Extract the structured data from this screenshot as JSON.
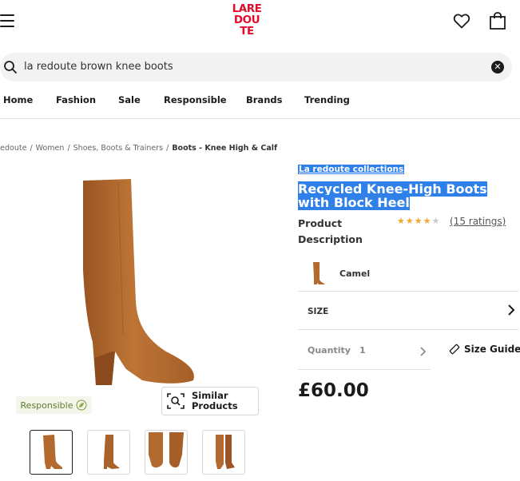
{
  "header": {
    "logo_lines": [
      "LARE",
      "DOU",
      "TE"
    ],
    "brand_color": "#e10b2c"
  },
  "search": {
    "query": "la redoute brown knee boots"
  },
  "nav": {
    "items": [
      "Home",
      "Fashion",
      "Sale",
      "Responsible",
      "Brands",
      "Trending"
    ]
  },
  "breadcrumb": {
    "items": [
      "Redoute",
      "Women",
      "Shoes, Boots & Trainers"
    ],
    "current": "Boots - Knee High & Calf",
    "separator": "/"
  },
  "product": {
    "brand": "La redoute collections",
    "title": "Recycled Knee-High Boots with Block Heel",
    "description_label_1": "Product",
    "description_label_2": "Description",
    "rating_stars": 4,
    "rating_max": 5,
    "ratings_text": "(15 ratings)",
    "color_name": "Camel",
    "size_label": "SIZE",
    "quantity_label": "Quantity",
    "quantity_value": "1",
    "size_guide_label": "Size Guide",
    "price": "£60.00",
    "responsible_badge": "Responsible",
    "similar_line1": "Similar",
    "similar_line2": "Products",
    "highlight_color": "#2f80e8",
    "boot_color": "#b36a2e"
  }
}
